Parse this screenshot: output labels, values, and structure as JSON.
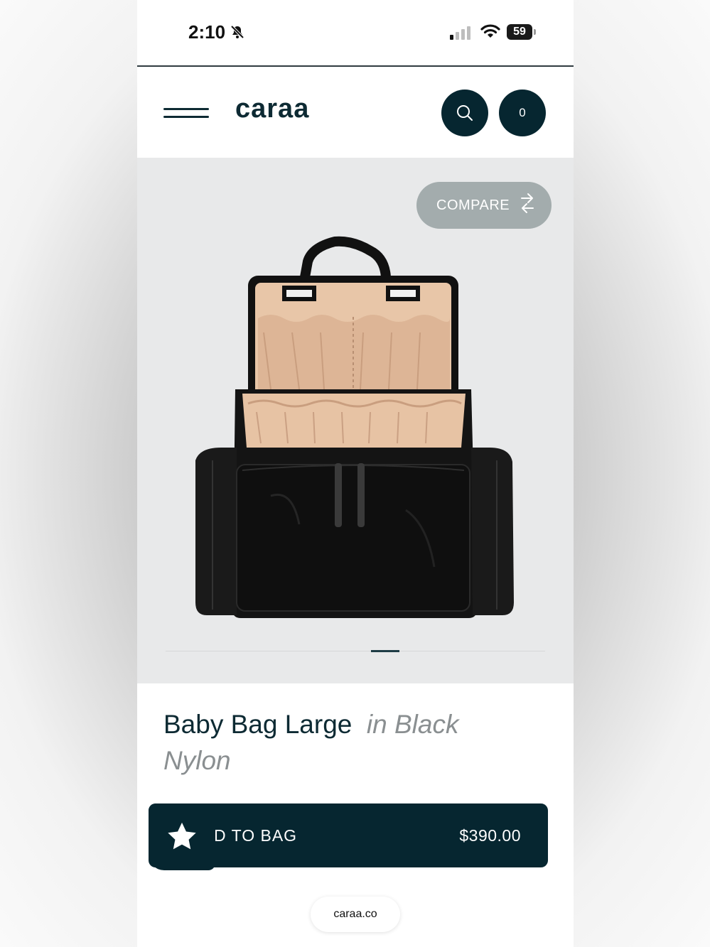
{
  "status_bar": {
    "time": "2:10",
    "battery": "59"
  },
  "header": {
    "logo": "caraa",
    "cart_count": "0"
  },
  "gallery": {
    "compare_label": "COMPARE"
  },
  "product": {
    "name": "Baby Bag Large",
    "variant": "in Black Nylon"
  },
  "purchase": {
    "add_label": "D TO BAG",
    "price": "$390.00"
  },
  "browser": {
    "url": "caraa.co"
  },
  "icons": [
    "bell-slash-icon",
    "signal-icon",
    "wifi-icon",
    "battery-icon",
    "menu-icon",
    "search-icon",
    "compare-arrows-icon",
    "star-icon"
  ],
  "colors": {
    "brand_dark": "#062630",
    "compare_pill": "#a3acad",
    "gallery_bg": "#e8e9ea"
  }
}
